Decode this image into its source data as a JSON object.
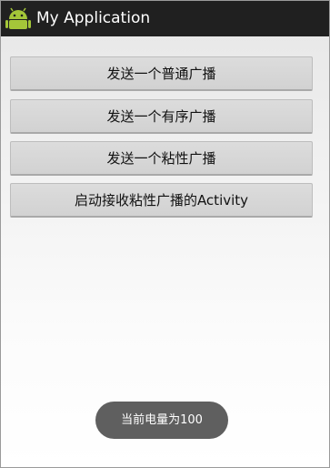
{
  "app": {
    "title": "My Application",
    "icon": "android-robot-icon",
    "colors": {
      "action_bar": "#202020",
      "robot": "#a4c639",
      "button_bg": "#d6d6d6",
      "toast_bg": "#5f5f5f"
    }
  },
  "main": {
    "buttons": [
      {
        "label": "发送一个普通广播"
      },
      {
        "label": "发送一个有序广播"
      },
      {
        "label": "发送一个粘性广播"
      },
      {
        "label": "启动接收粘性广播的Activity"
      }
    ]
  },
  "toast": {
    "text": "当前电量为100"
  }
}
